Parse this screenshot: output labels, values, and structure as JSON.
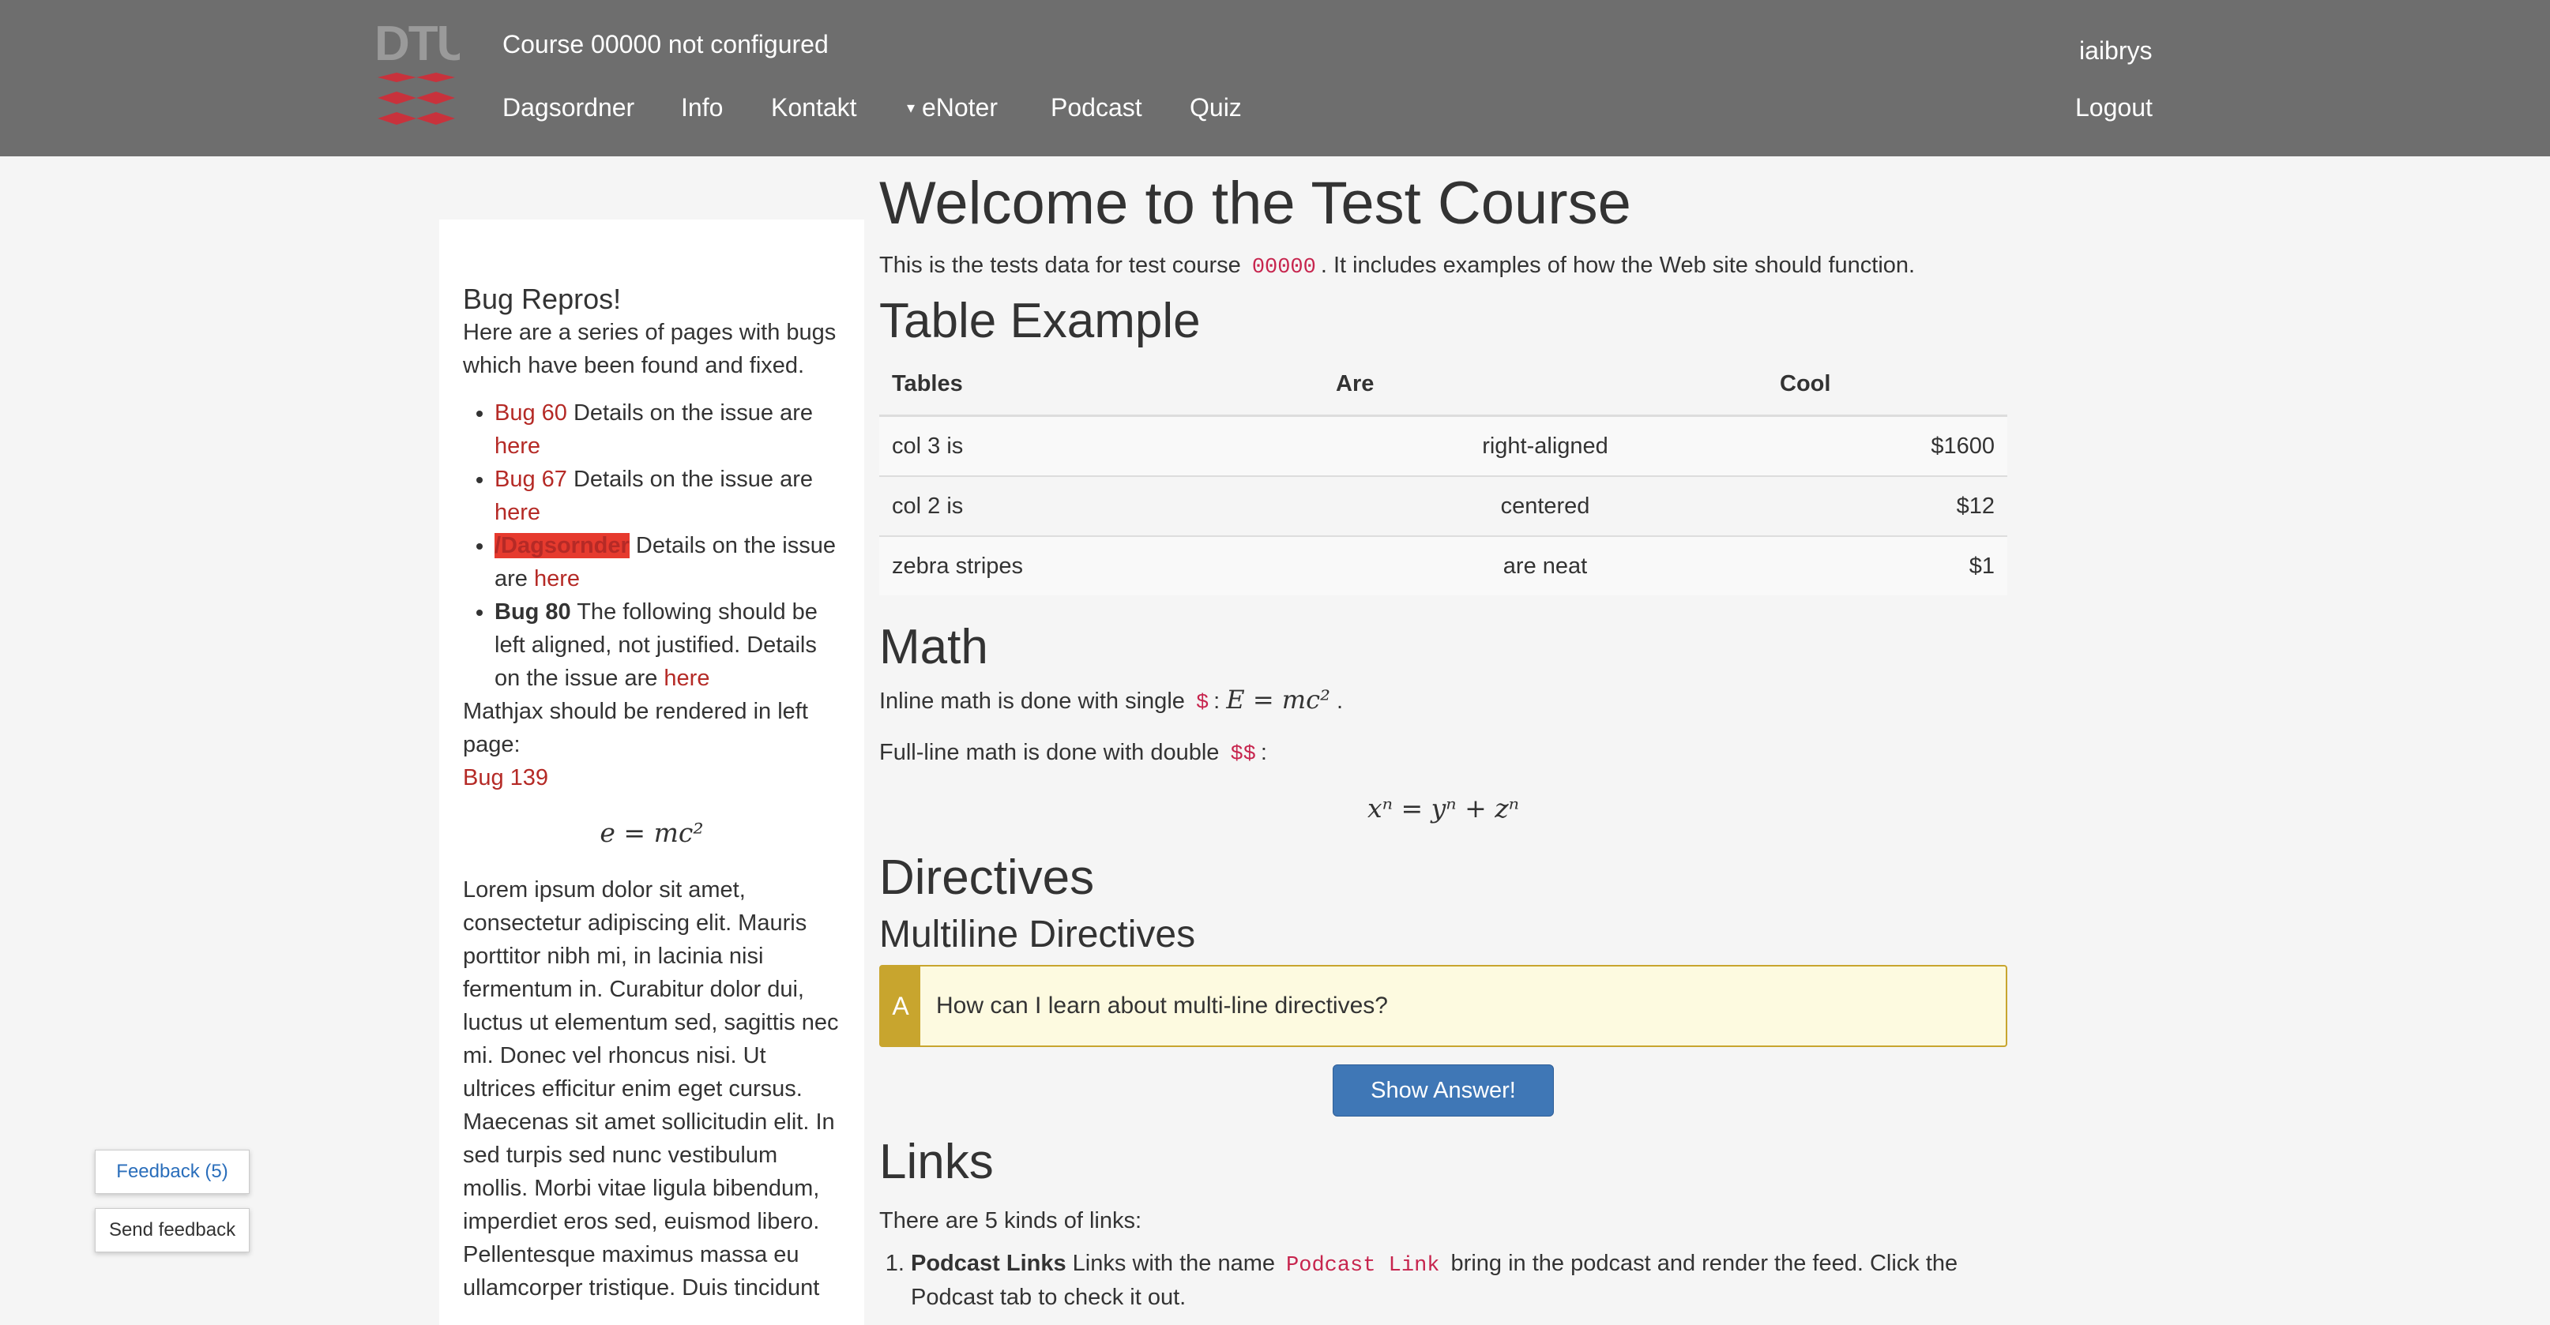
{
  "header": {
    "logo_text": "DTU",
    "course_title": "Course 00000 not configured",
    "nav": [
      "Dagsordner",
      "Info",
      "Kontakt",
      "eNoter",
      "Podcast",
      "Quiz"
    ],
    "user": "iaibrys",
    "logout": "Logout"
  },
  "sidebar": {
    "heading": "Bug Repros!",
    "intro": "Here are a series of pages with bugs which have been found and fixed.",
    "bugs": [
      {
        "link": "Bug 60",
        "text": " Details on the issue are ",
        "here": "here"
      },
      {
        "link": "Bug 67",
        "text": " Details on the issue are ",
        "here": "here"
      },
      {
        "link": "/Dagsornder",
        "text": " Details on the issue are ",
        "here": "here"
      },
      {
        "bold": "Bug 80",
        "text": " The following should be left aligned, not justified. Details on the issue are ",
        "here": "here"
      }
    ],
    "mathjax_note": "Mathjax should be rendered in left page:",
    "bug139": "Bug 139",
    "equation": "e = mc²",
    "lorem": "Lorem ipsum dolor sit amet, consectetur adipiscing elit. Mauris porttitor nibh mi, in lacinia nisi fermentum in. Curabitur dolor dui, luctus ut elementum sed, sagittis nec mi. Donec vel rhoncus nisi. Ut ultrices efficitur enim eget cursus. Maecenas sit amet sollicitudin elit. In sed turpis sed nunc vestibulum mollis. Morbi vitae ligula bibendum, imperdiet eros sed, euismod libero. Pellentesque maximus massa eu ullamcorper tristique. Duis tincidunt"
  },
  "main": {
    "title": "Welcome to the Test Course",
    "intro_pre": "This is the tests data for test course ",
    "intro_code": "00000",
    "intro_post": ". It includes examples of how the Web site should function.",
    "table_heading": "Table Example",
    "table": {
      "headers": [
        "Tables",
        "Are",
        "Cool"
      ],
      "rows": [
        [
          "col 3 is",
          "right-aligned",
          "$1600"
        ],
        [
          "col 2 is",
          "centered",
          "$12"
        ],
        [
          "zebra stripes",
          "are neat",
          "$1"
        ]
      ]
    },
    "math_heading": "Math",
    "inline_pre": "Inline math is done with single ",
    "inline_code": "$",
    "inline_math": "E = mc²",
    "fullline_pre": "Full-line math is done with double ",
    "fullline_code": "$$",
    "display_math": "xⁿ = yⁿ + zⁿ",
    "directives_heading": "Directives",
    "multiline_heading": "Multiline Directives",
    "qa_badge": "A",
    "qa_question": "How can I learn about multi-line directives?",
    "show_answer": "Show Answer!",
    "links_heading": "Links",
    "links_intro": "There are 5 kinds of links:",
    "link_item_bold": "Podcast Links",
    "link_item_text": " Links with the name ",
    "link_item_code": "Podcast Link",
    "link_item_post": " bring in the podcast and render the feed. Click the Podcast tab to check it out."
  },
  "feedback": {
    "count_button": "Feedback (5)",
    "send_button": "Send feedback"
  },
  "colors": {
    "navbar": "#6e6e6e",
    "link": "#b52a26",
    "button": "#3f77b6",
    "qa_accent": "#c8a52e"
  }
}
